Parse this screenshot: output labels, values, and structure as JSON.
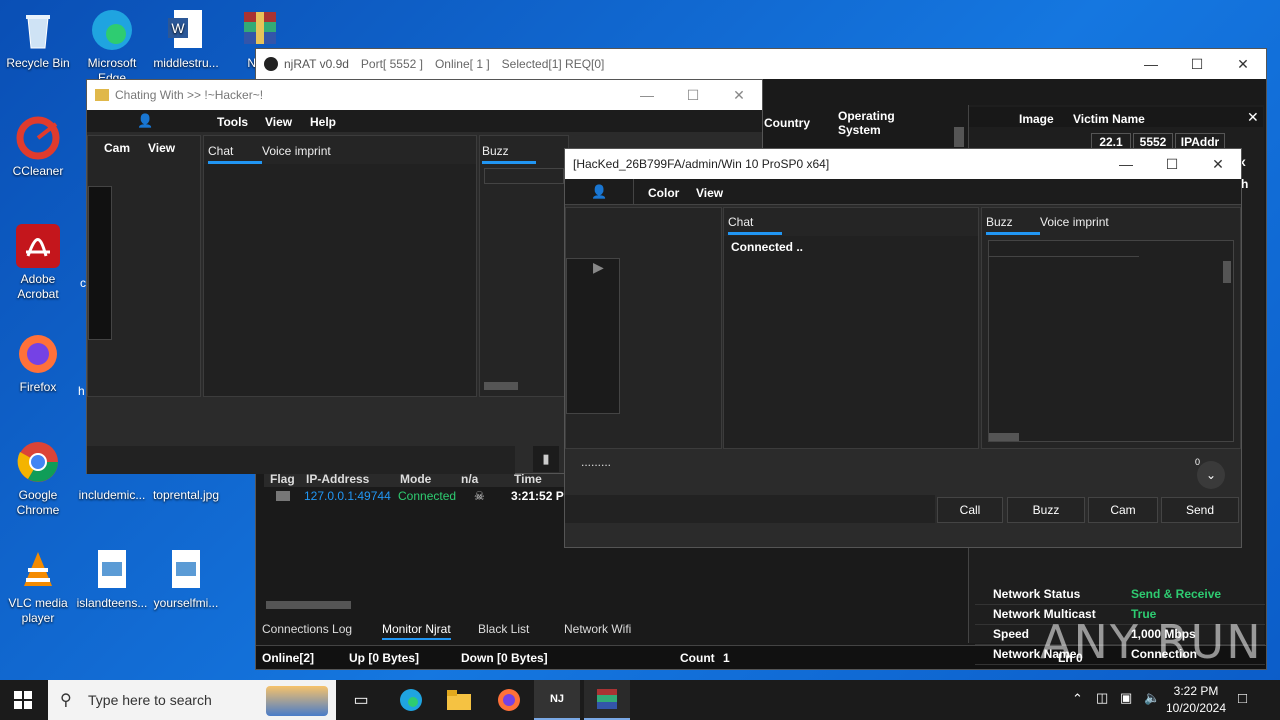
{
  "desktop": {
    "icons": [
      {
        "label": "Recycle Bin"
      },
      {
        "label": "Microsoft Edge"
      },
      {
        "label": "middlestru..."
      },
      {
        "label": "Njrat"
      },
      {
        "label": "CCleaner"
      },
      {
        "label": "Adobe Acrobat"
      },
      {
        "label": "Firefox"
      },
      {
        "label": "Google Chrome"
      },
      {
        "label": "includemic..."
      },
      {
        "label": "toprental.jpg"
      },
      {
        "label": "VLC media player"
      },
      {
        "label": "islandteens..."
      },
      {
        "label": "yourselfmi..."
      },
      {
        "label": "c"
      },
      {
        "label": "h"
      }
    ]
  },
  "njrat": {
    "title": "njRAT v0.9d",
    "port": "Port[ 5552 ]",
    "online": "Online[ 1 ]",
    "selected": "Selected[1] REQ[0]",
    "col_country": "Country",
    "col_os": "Operating System",
    "columns": {
      "flag": "Flag",
      "ip": "IP-Address",
      "mode": "Mode",
      "na": "n/a",
      "time": "Time"
    },
    "row": {
      "ip": "127.0.0.1:49744",
      "mode": "Connected",
      "time": "3:21:52 P"
    },
    "bottom_tabs": [
      "Connections Log",
      "Monitor Njrat",
      "Black List",
      "Network Wifi"
    ],
    "status": {
      "online": "Online[2]",
      "up": "Up [0 Bytes]",
      "down": "Down [0 Bytes]",
      "count_label": "Count",
      "count_value": "1",
      "ln": "Ln  0"
    },
    "side": {
      "header_image": "Image",
      "header_victim": "Victim Name",
      "cells": [
        "22.1",
        "5552",
        "IPAddr"
      ],
      "extra": [
        "x",
        "h"
      ],
      "network": [
        {
          "key": "Network Status",
          "value": "Send & Receive"
        },
        {
          "key": "Network Multicast",
          "value": "True"
        },
        {
          "key": "Speed",
          "value": "1,000 Mbps"
        },
        {
          "key": "Network Name",
          "value": "Connection"
        }
      ]
    }
  },
  "chat1": {
    "title": "Chating With >> !~Hacker~!",
    "menu": [
      "Tools",
      "View",
      "Help"
    ],
    "submenu": [
      "Cam",
      "View"
    ],
    "tabs": [
      "Chat",
      "Voice imprint"
    ],
    "buzz": "Buzz"
  },
  "chat2": {
    "title": "[HacKed_26B799FA/admin/Win 10 ProSP0 x64]",
    "menu": [
      "Color",
      "View"
    ],
    "tabs": [
      "Chat"
    ],
    "right_tabs": [
      "Buzz",
      "Voice imprint"
    ],
    "message": "Connected ..",
    "dots": ".........",
    "badge": "0",
    "buttons": [
      "Call",
      "Buzz",
      "Cam",
      "Send"
    ]
  },
  "taskbar": {
    "search_placeholder": "Type here to search",
    "time": "3:22 PM",
    "date": "10/20/2024"
  },
  "watermark": "ANY RUN"
}
